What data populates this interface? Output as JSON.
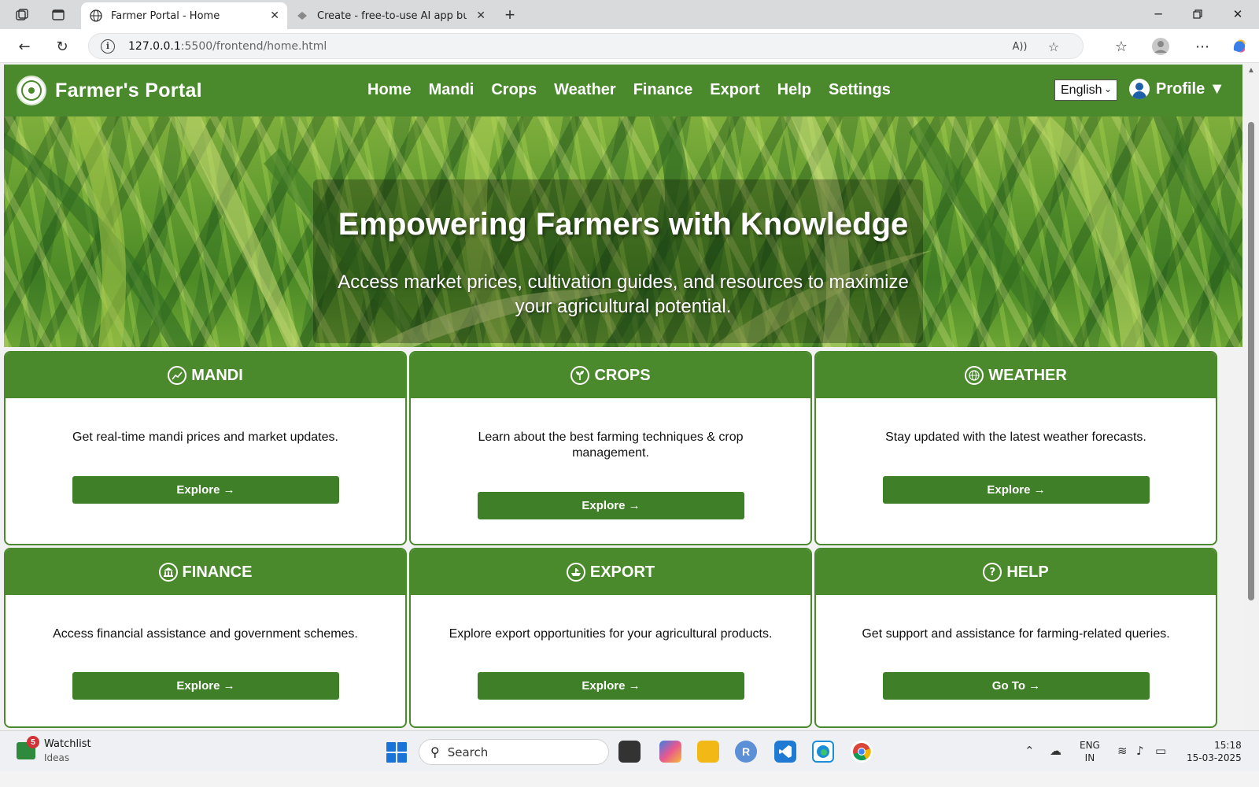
{
  "browser": {
    "tabs": [
      {
        "title": "Farmer Portal - Home",
        "active": true
      },
      {
        "title": "Create - free-to-use AI app builde",
        "active": false
      }
    ],
    "url_host": "127.0.0.1",
    "url_path": ":5500/frontend/home.html"
  },
  "site": {
    "brand": "Farmer's Portal",
    "nav": [
      "Home",
      "Mandi",
      "Crops",
      "Weather",
      "Finance",
      "Export",
      "Help",
      "Settings"
    ],
    "language": "English",
    "profile_label": "Profile ▼",
    "accent_color": "#4a8a2d"
  },
  "hero": {
    "title": "Empowering Farmers with Knowledge",
    "subtitle": "Access market prices, cultivation guides, and resources to maximize your agricultural potential."
  },
  "cards": [
    {
      "icon": "chart-icon",
      "title": "MANDI",
      "text": "Get real-time mandi prices and market updates.",
      "button": "Explore →"
    },
    {
      "icon": "sprout-icon",
      "title": "CROPS",
      "text": "Learn about the best farming techniques & crop management.",
      "button": "Explore →"
    },
    {
      "icon": "globe-icon",
      "title": "WEATHER",
      "text": "Stay updated with the latest weather forecasts.",
      "button": "Explore →"
    },
    {
      "icon": "bank-icon",
      "title": "FINANCE",
      "text": "Access financial assistance and government schemes.",
      "button": "Explore →"
    },
    {
      "icon": "ship-icon",
      "title": "EXPORT",
      "text": "Explore export opportunities for your agricultural products.",
      "button": "Explore →"
    },
    {
      "icon": "help-icon",
      "title": "HELP",
      "text": "Get support and assistance for farming-related queries.",
      "button": "Go To →"
    }
  ],
  "taskbar": {
    "widget_title": "Watchlist",
    "widget_sub": "Ideas",
    "widget_badge": "5",
    "search_label": "Search",
    "lang_line1": "ENG",
    "lang_line2": "IN",
    "time": "15:18",
    "date": "15-03-2025"
  }
}
